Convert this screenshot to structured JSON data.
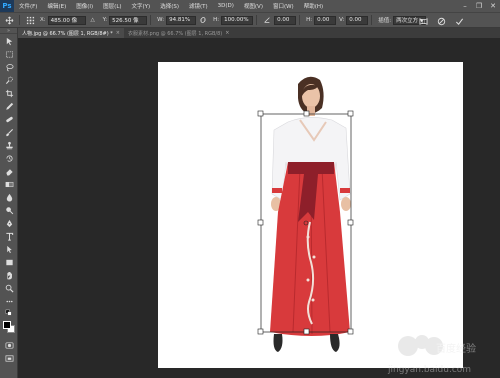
{
  "app": {
    "logo": "Ps"
  },
  "menu": [
    "文件(F)",
    "编辑(E)",
    "图像(I)",
    "图层(L)",
    "文字(Y)",
    "选择(S)",
    "滤镜(T)",
    "3D(D)",
    "视图(V)",
    "窗口(W)",
    "帮助(H)"
  ],
  "window_controls": {
    "minimize": "–",
    "restore": "❐",
    "close": "✕"
  },
  "options": {
    "x_label": "X:",
    "x_value": "485.00 像",
    "y_label": "Y:",
    "y_value": "526.50 像",
    "w_label": "W:",
    "w_value": "94.81%",
    "h_label": "H:",
    "h_value": "100.00%",
    "angle_label": "△",
    "angle_value": "0.00",
    "hskew_label": "H:",
    "hskew_value": "0.00",
    "vskew_label": "V:",
    "vskew_value": "0.00",
    "interp_label": "插值:",
    "interp_value": "两次立方"
  },
  "tabs": [
    {
      "label": "人物.jpg @ 66.7% (图层 1, RGB/8#) *",
      "close": "×",
      "active": true
    },
    {
      "label": "衣服素材.png @ 66.7% (图层 1, RGB/8)",
      "close": "×",
      "active": false
    }
  ],
  "watermark": {
    "text": "jingyan.baidu.com",
    "brand": "百度经验"
  },
  "colors": {
    "panel": "#535353",
    "canvas_bg": "#282828",
    "skirt": "#d83a3c",
    "blouse": "#f4f4f6"
  }
}
